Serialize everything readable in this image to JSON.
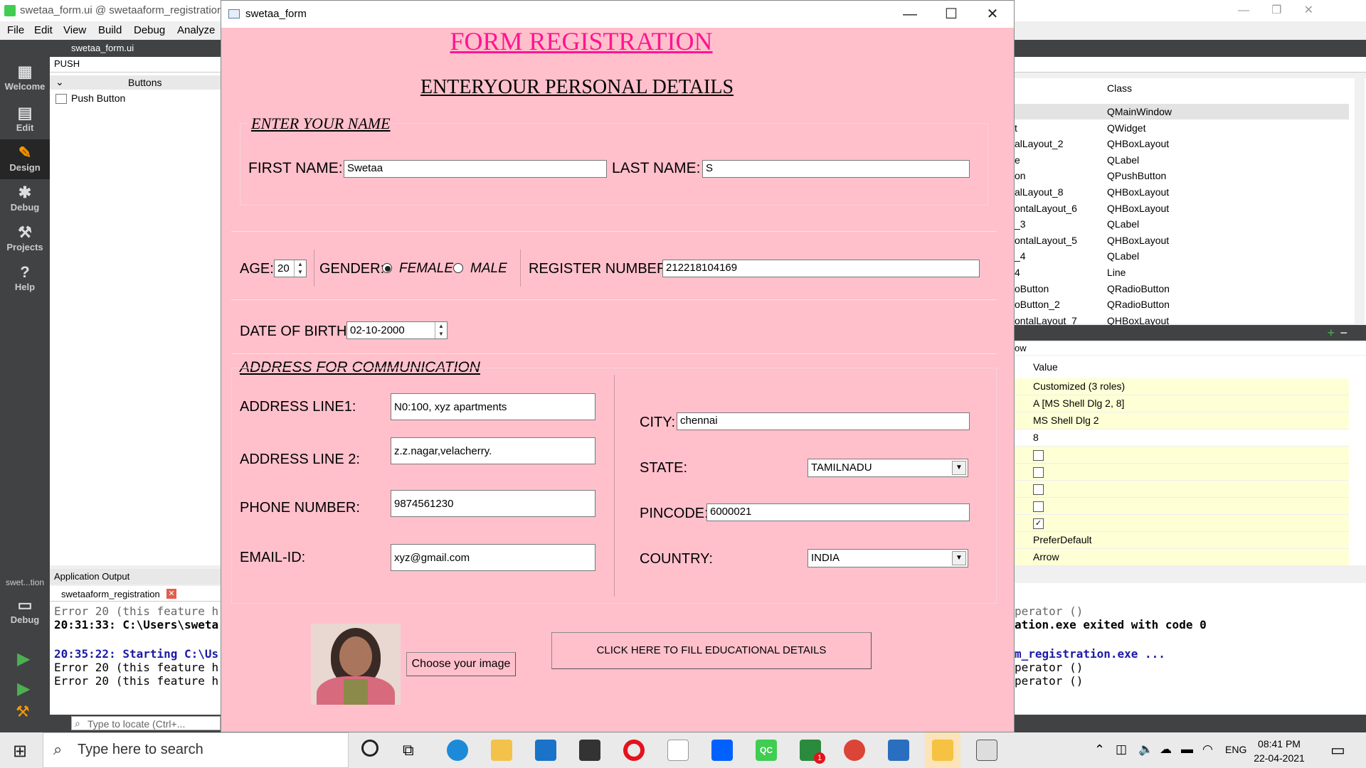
{
  "ide": {
    "title": "swetaa_form.ui @ swetaaform_registration",
    "menu": [
      "File",
      "Edit",
      "View",
      "Build",
      "Debug",
      "Analyze"
    ],
    "modes": [
      "Welcome",
      "Edit",
      "Design",
      "Debug",
      "Projects",
      "Help"
    ],
    "bottom_mode_label": "swet...tion",
    "bottom_mode": "Debug",
    "open_file": "swetaa_form.ui",
    "widget_filter": "PUSH",
    "widget_category": "Buttons",
    "widget_item": "Push Button",
    "app_output_header": "Application Output",
    "app_output_tab": "swetaaform_registration",
    "app_output_lines": [
      "Error 20 (this feature h",
      "20:31:33: C:\\Users\\sweta",
      "",
      "20:35:22: Starting C:\\Us",
      "Error 20 (this feature h",
      "Error 20 (this feature h"
    ],
    "locator_placeholder": "Type to locate (Ctrl+...",
    "object_inspector": {
      "class_header": "Class",
      "rows": [
        {
          "name": "",
          "cls": "QMainWindow"
        },
        {
          "name": "t",
          "cls": "QWidget"
        },
        {
          "name": "alLayout_2",
          "cls": "QHBoxLayout"
        },
        {
          "name": "e",
          "cls": "QLabel"
        },
        {
          "name": "on",
          "cls": "QPushButton"
        },
        {
          "name": "alLayout_8",
          "cls": "QHBoxLayout"
        },
        {
          "name": "ontalLayout_6",
          "cls": "QHBoxLayout"
        },
        {
          "name": "_3",
          "cls": "QLabel"
        },
        {
          "name": "ontalLayout_5",
          "cls": "QHBoxLayout"
        },
        {
          "name": "_4",
          "cls": "QLabel"
        },
        {
          "name": "4",
          "cls": "Line"
        },
        {
          "name": "oButton",
          "cls": "QRadioButton"
        },
        {
          "name": "oButton_2",
          "cls": "QRadioButton"
        },
        {
          "name": "ontalLayout_7",
          "cls": "QHBoxLayout"
        }
      ]
    },
    "prop_partial_label": "ow",
    "property_editor": {
      "value_header": "Value",
      "rows": [
        "Customized (3 roles)",
        "A  [MS Shell Dlg 2, 8]",
        "MS Shell Dlg 2",
        "8",
        "",
        "",
        "",
        "",
        "",
        "PreferDefault",
        "Arrow"
      ],
      "checkbox_states": [
        false,
        false,
        false,
        false,
        true
      ]
    },
    "right_output_lines": [
      "perator ()",
      "ation.exe exited with code 0",
      "",
      "m_registration.exe ...",
      "perator ()",
      "perator ()"
    ]
  },
  "form": {
    "window_title": "swetaa_form",
    "heading": "FORM REGISTRATION",
    "subheading": "ENTERYOUR PERSONAL DETAILS",
    "name_group": "ENTER YOUR NAME",
    "first_name_label": "FIRST NAME:",
    "first_name": "Swetaa",
    "last_name_label": "LAST NAME:",
    "last_name": "S",
    "age_label": "AGE:",
    "age": "20",
    "gender_label": "GENDER:",
    "gender_female": "FEMALE",
    "gender_male": "MALE",
    "gender_selected": "FEMALE",
    "register_label": "REGISTER  NUMBER:",
    "register_number": "212218104169",
    "dob_label": "DATE OF BIRTH:",
    "dob": "02-10-2000",
    "address_heading": "ADDRESS FOR COMMUNICATION",
    "address1_label": "ADDRESS LINE1:",
    "address1": "N0:100, xyz apartments",
    "address2_label": "ADDRESS LINE 2:",
    "address2": "z.z.nagar,velacherry.",
    "phone_label": "PHONE NUMBER:",
    "phone": "9874561230",
    "email_label": "EMAIL-ID:",
    "email": "xyz@gmail.com",
    "city_label": "CITY:",
    "city": "chennai",
    "state_label": "STATE:",
    "state": "TAMILNADU",
    "pincode_label": "PINCODE:",
    "pincode": "6000021",
    "country_label": "COUNTRY:",
    "country": "INDIA",
    "choose_image": "Choose your image",
    "educational_button": "CLICK HERE TO FILL EDUCATIONAL DETAILS",
    "heading_color": "#ff1493"
  },
  "taskbar": {
    "search_placeholder": "Type here to search",
    "language": "ENG",
    "time": "08:41 PM",
    "date": "22-04-2021",
    "notification_badge": "1"
  }
}
